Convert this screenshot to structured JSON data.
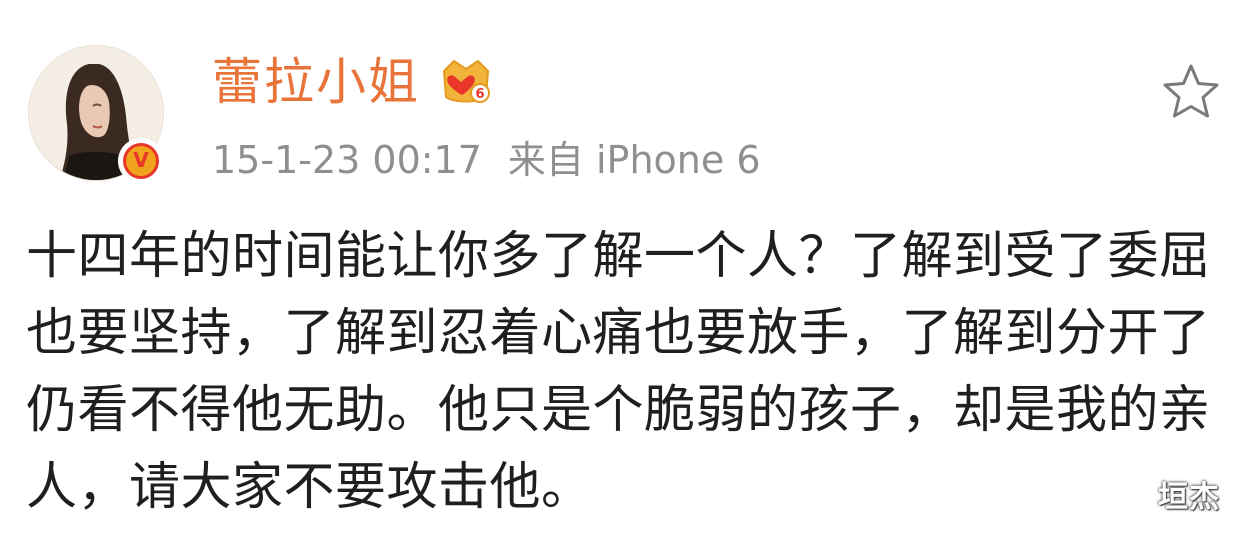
{
  "post": {
    "author": {
      "name": "蕾拉小姐",
      "vip_level": "6",
      "verified_mark": "V"
    },
    "meta": {
      "timestamp": "15-1-23 00:17",
      "source": "来自 iPhone 6"
    },
    "content": "十四年的时间能让你多了解一个人？了解到受了委屈也要坚持，了解到忍着心痛也要放手，了解到分开了仍看不得他无助。他只是个脆弱的孩子，却是我的亲人，请大家不要攻击他。",
    "actions": {
      "favorite_icon": "star-outline-icon"
    },
    "watermark": "垣杰"
  },
  "colors": {
    "username": "#e8743a",
    "meta": "#8f8f8f",
    "text": "#1f1f1f",
    "verified_badge": "#f0a31c",
    "verified_ring": "#e8362b"
  }
}
